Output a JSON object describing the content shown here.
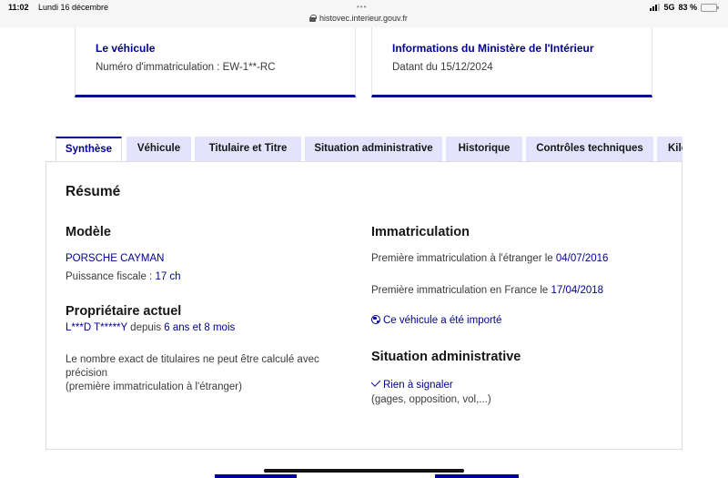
{
  "status_bar": {
    "time": "11:02",
    "date": "Lundi 16 décembre",
    "url": "histovec.interieur.gouv.fr",
    "network": "5G",
    "battery": "83 %",
    "battery_level": 0.83
  },
  "cards": {
    "vehicle": {
      "title": "Le véhicule",
      "text": "Numéro d'immatriculation : EW-1**-RC"
    },
    "ministry": {
      "title": "Informations du Ministère de l'Intérieur",
      "text": "Datant du 15/12/2024"
    }
  },
  "tabs": [
    {
      "label": "Synthèse"
    },
    {
      "label": "Véhicule"
    },
    {
      "label": "Titulaire et Titre"
    },
    {
      "label": "Situation administrative"
    },
    {
      "label": "Historique"
    },
    {
      "label": "Contrôles techniques"
    },
    {
      "label": "Kilo"
    }
  ],
  "active_tab": "Synthèse",
  "summary": {
    "heading": "Résumé",
    "model": {
      "heading": "Modèle",
      "name": "PORSCHE CAYMAN",
      "power_label": "Puissance fiscale : ",
      "power_value": "17 ch"
    },
    "owner": {
      "heading": "Propriétaire actuel",
      "name": "L***D T*****Y",
      "since_label": " depuis ",
      "duration": "6 ans et 8 mois",
      "note_line1": "Le nombre exact de titulaires ne peut être calculé avec",
      "note_line2": "précision",
      "note_line3": "(première immatriculation à l'étranger)"
    },
    "registration": {
      "heading": "Immatriculation",
      "foreign_label": "Première immatriculation à l'étranger le ",
      "foreign_date": "04/07/2016",
      "france_label": "Première immatriculation en France le ",
      "france_date": "17/04/2018",
      "imported_link": "Ce véhicule a été importé"
    },
    "admin": {
      "heading": "Situation administrative",
      "status": "Rien à signaler",
      "details": "(gages, opposition, vol,...)"
    }
  },
  "colors": {
    "accent": "#000091",
    "tab_background": "#e3e3fd"
  }
}
